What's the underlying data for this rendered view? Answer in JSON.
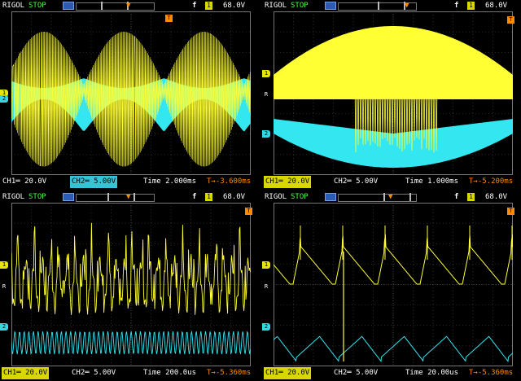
{
  "colors": {
    "ch1": "#ffff33",
    "ch2": "#33e6f0",
    "trigger": "#ff8c00",
    "grid": "#4a4a4a",
    "state": "#44ff44"
  },
  "panels": [
    {
      "brand": "RIGOL",
      "state": "STOP",
      "edge": "f",
      "trig_src": "1",
      "trig_level": "68.0V",
      "ch1": "CH1═ 20.0V",
      "ch2": "CH2═ 5.00V",
      "ch_selected": "ch2",
      "time": "Time 2.000ms",
      "offset": "T→-3.600ms",
      "markers": [
        "1",
        "2"
      ],
      "trig_right": "T",
      "waveform": "ch-envelope-3cycle"
    },
    {
      "brand": "RIGOL",
      "state": "STOP",
      "edge": "f",
      "trig_src": "1",
      "trig_level": "68.0V",
      "ch1": "CH1═ 20.0V",
      "ch2": "CH2═ 5.00V",
      "ch_selected": "ch1",
      "time": "Time 1.000ms",
      "offset": "T→-5.200ms",
      "markers": [
        "1",
        "R",
        "2"
      ],
      "trig_right": "T",
      "waveform": "burst-single"
    },
    {
      "brand": "RIGOL",
      "state": "STOP",
      "edge": "f",
      "trig_src": "1",
      "trig_level": "68.0V",
      "ch1": "CH1═ 20.0V",
      "ch2": "CH2═ 5.00V",
      "ch_selected": "ch1",
      "time": "Time 200.0us",
      "offset": "T→-5.360ms",
      "markers": [
        "1",
        "R",
        "2"
      ],
      "trig_right": "T",
      "waveform": "fast-oscillation"
    },
    {
      "brand": "RIGOL",
      "state": "STOP",
      "edge": "f",
      "trig_src": "1",
      "trig_level": "68.0V",
      "ch1": "CH1═ 20.0V",
      "ch2": "CH2═ 5.00V",
      "ch_selected": "ch1",
      "time": "Time 20.00us",
      "offset": "T→-5.360ms",
      "markers": [
        "1",
        "R",
        "2"
      ],
      "trig_right": "T",
      "waveform": "sawtooth-spikes"
    }
  ]
}
